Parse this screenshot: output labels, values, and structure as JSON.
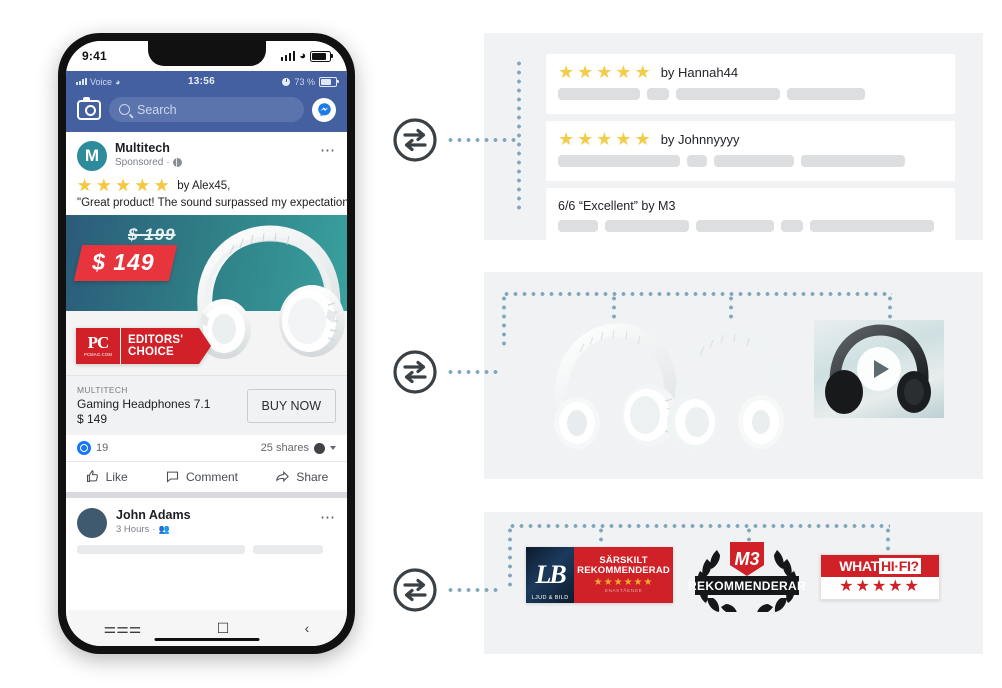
{
  "phone": {
    "ios_status": {
      "time": "9:41",
      "signal_icon": "signal-bars-icon",
      "wifi_icon": "wifi-icon",
      "battery_icon": "battery-icon"
    },
    "fb_status": {
      "carrier": "Voice",
      "time": "13:56",
      "battery_pct": "73 %",
      "alarm_icon": "alarm-icon"
    },
    "search": {
      "placeholder": "Search",
      "camera_icon": "camera-icon",
      "search_icon": "search-icon",
      "messenger_icon": "messenger-icon"
    },
    "post": {
      "avatar_letter": "M",
      "page_name": "Multitech",
      "sponsored": "Sponsored",
      "privacy_icon": "globe-icon",
      "menu_icon": "more-options-icon",
      "rating_stars": 5,
      "review_by": "by Alex45,",
      "review_quote": "\"Great product!  The sound surpassed my expectations!\"",
      "price_old": "$ 199",
      "price_new": "$ 149",
      "badge": {
        "logo": "PC",
        "logo_sub": "PCMAG.COM",
        "line1": "EDITORS'",
        "line2": "CHOICE"
      },
      "product": {
        "brand": "MULTITECH",
        "title": "Gaming Headphones  7.1",
        "price": "$ 149",
        "buy_label": "BUY NOW"
      },
      "reactions": {
        "count": "19",
        "shares": "25 shares",
        "like_icon": "like-reaction-icon",
        "privacy_icon": "privacy-icon",
        "caret_icon": "chevron-down-icon"
      },
      "actions": [
        {
          "label": "Like",
          "icon": "thumbs-up-icon"
        },
        {
          "label": "Comment",
          "icon": "comment-bubble-icon"
        },
        {
          "label": "Share",
          "icon": "share-arrow-icon"
        }
      ]
    },
    "post2": {
      "name": "John Adams",
      "time": "3 Hours",
      "audience_icon": "friends-icon",
      "menu_icon": "more-options-icon"
    },
    "navbar": {
      "recents_icon": "recents-icon",
      "home_icon": "home-icon",
      "back_icon": "back-icon"
    }
  },
  "connector_icon": "swap-exchange-icon",
  "panels": [
    {
      "name": "reviews",
      "cards": [
        {
          "type": "stars",
          "stars": 5,
          "by": "by Hannah44",
          "bars": [
            82,
            22,
            104,
            78
          ]
        },
        {
          "type": "stars",
          "stars": 5,
          "by": "by Johnnyyyy",
          "bars": [
            122,
            20,
            80,
            104
          ]
        },
        {
          "type": "text",
          "title": "6/6 “Excellent” by M3",
          "bars": [
            40,
            84,
            78,
            22,
            124
          ]
        }
      ]
    },
    {
      "name": "media",
      "items": [
        {
          "type": "product-image",
          "alt": "white-headphones-angle-1"
        },
        {
          "type": "product-image",
          "alt": "white-headphones-angle-2"
        },
        {
          "type": "video",
          "alt": "headphones-video-thumbnail",
          "play_icon": "play-button-icon"
        }
      ]
    },
    {
      "name": "awards",
      "items": [
        {
          "type": "ljud-bild",
          "logo": "LB",
          "logo_sub": "LJUD & BILD",
          "line1": "SÄRSKILT",
          "line2": "REKOMMENDERAD",
          "stars": 6,
          "caption": "ENASTÅENDE"
        },
        {
          "type": "m3",
          "shield": "M3",
          "band": "REKOMMENDERAR"
        },
        {
          "type": "what-hifi",
          "word1": "WHAT",
          "word2": "HI·FI?",
          "stars": 5
        }
      ]
    }
  ],
  "colors": {
    "fb_blue": "#4460a0",
    "panel_bg": "#f1f2f3",
    "dot_blue": "#7fa8bd",
    "award_red": "#cf2127",
    "price_red": "#e8343c",
    "star_gold": "#f3cc4a"
  }
}
